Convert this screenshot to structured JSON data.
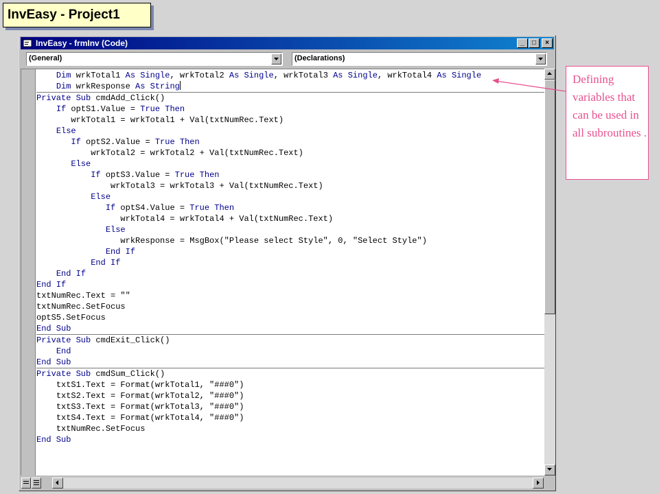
{
  "slide_title": "InvEasy - Project1",
  "window": {
    "title": "InvEasy - frmInv (Code)",
    "buttons": {
      "minimize": "_",
      "maximize": "□",
      "close": "×"
    }
  },
  "object_combo": {
    "value": "(General)"
  },
  "procedure_combo": {
    "value": "(Declarations)"
  },
  "code_lines": [
    {
      "indent": "    ",
      "parts": [
        [
          "kw",
          "Dim"
        ],
        [
          "t",
          " wrkTotal1 "
        ],
        [
          "kw",
          "As Single"
        ],
        [
          "t",
          ", wrkTotal2 "
        ],
        [
          "kw",
          "As Single"
        ],
        [
          "t",
          ", wrkTotal3 "
        ],
        [
          "kw",
          "As Single"
        ],
        [
          "t",
          ", wrkTotal4 "
        ],
        [
          "kw",
          "As Single"
        ]
      ]
    },
    {
      "indent": "    ",
      "parts": [
        [
          "kw",
          "Dim"
        ],
        [
          "t",
          " wrkResponse "
        ],
        [
          "kw",
          "As String"
        ]
      ],
      "cursor": true
    },
    {
      "sep": true
    },
    {
      "indent": "",
      "parts": [
        [
          "kw",
          "Private Sub"
        ],
        [
          "t",
          " cmdAdd_Click()"
        ]
      ]
    },
    {
      "indent": "    ",
      "parts": [
        [
          "kw",
          "If"
        ],
        [
          "t",
          " optS1.Value = "
        ],
        [
          "kw",
          "True Then"
        ]
      ]
    },
    {
      "indent": "       ",
      "parts": [
        [
          "t",
          "wrkTotal1 = wrkTotal1 + Val(txtNumRec.Text)"
        ]
      ]
    },
    {
      "indent": "    ",
      "parts": [
        [
          "kw",
          "Else"
        ]
      ]
    },
    {
      "indent": "       ",
      "parts": [
        [
          "kw",
          "If"
        ],
        [
          "t",
          " optS2.Value = "
        ],
        [
          "kw",
          "True Then"
        ]
      ]
    },
    {
      "indent": "           ",
      "parts": [
        [
          "t",
          "wrkTotal2 = wrkTotal2 + Val(txtNumRec.Text)"
        ]
      ]
    },
    {
      "indent": "       ",
      "parts": [
        [
          "kw",
          "Else"
        ]
      ]
    },
    {
      "indent": "           ",
      "parts": [
        [
          "kw",
          "If"
        ],
        [
          "t",
          " optS3.Value = "
        ],
        [
          "kw",
          "True Then"
        ]
      ]
    },
    {
      "indent": "               ",
      "parts": [
        [
          "t",
          "wrkTotal3 = wrkTotal3 + Val(txtNumRec.Text)"
        ]
      ]
    },
    {
      "indent": "           ",
      "parts": [
        [
          "kw",
          "Else"
        ]
      ]
    },
    {
      "indent": "              ",
      "parts": [
        [
          "kw",
          "If"
        ],
        [
          "t",
          " optS4.Value = "
        ],
        [
          "kw",
          "True Then"
        ]
      ]
    },
    {
      "indent": "                 ",
      "parts": [
        [
          "t",
          "wrkTotal4 = wrkTotal4 + Val(txtNumRec.Text)"
        ]
      ]
    },
    {
      "indent": "              ",
      "parts": [
        [
          "kw",
          "Else"
        ]
      ]
    },
    {
      "indent": "                 ",
      "parts": [
        [
          "t",
          "wrkResponse = MsgBox(\"Please select Style\", 0, \"Select Style\")"
        ]
      ]
    },
    {
      "indent": "              ",
      "parts": [
        [
          "kw",
          "End If"
        ]
      ]
    },
    {
      "indent": "           ",
      "parts": [
        [
          "kw",
          "End If"
        ]
      ]
    },
    {
      "indent": "    ",
      "parts": [
        [
          "kw",
          "End If"
        ]
      ]
    },
    {
      "indent": "",
      "parts": [
        [
          "kw",
          "End If"
        ]
      ]
    },
    {
      "indent": "",
      "parts": [
        [
          "t",
          "txtNumRec.Text = \"\""
        ]
      ]
    },
    {
      "indent": "",
      "parts": [
        [
          "t",
          "txtNumRec.SetFocus"
        ]
      ]
    },
    {
      "indent": "",
      "parts": [
        [
          "t",
          "optS5.SetFocus"
        ]
      ]
    },
    {
      "indent": "",
      "parts": [
        [
          "kw",
          "End Sub"
        ]
      ]
    },
    {
      "sep": true
    },
    {
      "indent": "",
      "parts": [
        [
          "kw",
          "Private Sub"
        ],
        [
          "t",
          " cmdExit_Click()"
        ]
      ]
    },
    {
      "indent": "    ",
      "parts": [
        [
          "kw",
          "End"
        ]
      ]
    },
    {
      "indent": "",
      "parts": [
        [
          "kw",
          "End Sub"
        ]
      ]
    },
    {
      "sep": true
    },
    {
      "indent": "",
      "parts": [
        [
          "kw",
          "Private Sub"
        ],
        [
          "t",
          " cmdSum_Click()"
        ]
      ]
    },
    {
      "indent": "    ",
      "parts": [
        [
          "t",
          "txtS1.Text = Format(wrkTotal1, \"###0\")"
        ]
      ]
    },
    {
      "indent": "    ",
      "parts": [
        [
          "t",
          "txtS2.Text = Format(wrkTotal2, \"###0\")"
        ]
      ]
    },
    {
      "indent": "    ",
      "parts": [
        [
          "t",
          "txtS3.Text = Format(wrkTotal3, \"###0\")"
        ]
      ]
    },
    {
      "indent": "    ",
      "parts": [
        [
          "t",
          "txtS4.Text = Format(wrkTotal4, \"###0\")"
        ]
      ]
    },
    {
      "indent": "    ",
      "parts": [
        [
          "t",
          "txtNumRec.SetFocus"
        ]
      ]
    },
    {
      "indent": "",
      "parts": [
        [
          "kw",
          "End Sub"
        ]
      ]
    }
  ],
  "callout": {
    "text": "Defining variables that can be used in all subroutines ."
  },
  "colors": {
    "keyword": "#00008b",
    "callout": "#e8508f",
    "titlebar": "#000080"
  },
  "icons": [
    "app-icon",
    "dropdown-arrow-icon",
    "scroll-up-icon",
    "scroll-down-icon",
    "scroll-left-icon",
    "scroll-right-icon",
    "procedure-view-icon",
    "full-module-view-icon"
  ]
}
